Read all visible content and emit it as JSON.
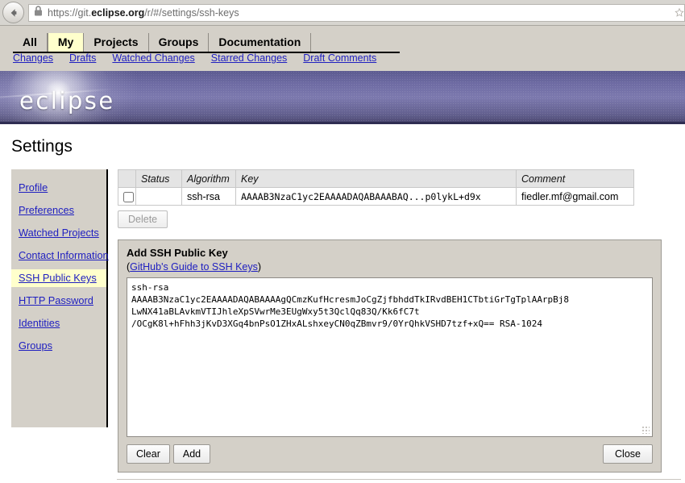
{
  "browser": {
    "url_prefix": "https://git.",
    "url_domain": "eclipse.org",
    "url_suffix": "/r/#/settings/ssh-keys",
    "back_icon": "back-arrow-icon",
    "lock_icon": "lock-icon",
    "star_icon": "star-icon"
  },
  "gerrit_nav": {
    "tabs": [
      {
        "label": "All",
        "selected": false
      },
      {
        "label": "My",
        "selected": true
      },
      {
        "label": "Projects",
        "selected": false
      },
      {
        "label": "Groups",
        "selected": false
      },
      {
        "label": "Documentation",
        "selected": false
      }
    ],
    "subtabs": [
      "Changes",
      "Drafts",
      "Watched Changes",
      "Starred Changes",
      "Draft Comments"
    ]
  },
  "banner": {
    "wordmark": "eclipse"
  },
  "page": {
    "title": "Settings"
  },
  "sidebar": {
    "items": [
      {
        "label": "Profile",
        "active": false
      },
      {
        "label": "Preferences",
        "active": false
      },
      {
        "label": "Watched Projects",
        "active": false
      },
      {
        "label": "Contact Information",
        "active": false
      },
      {
        "label": "SSH Public Keys",
        "active": true
      },
      {
        "label": "HTTP Password",
        "active": false
      },
      {
        "label": "Identities",
        "active": false
      },
      {
        "label": "Groups",
        "active": false
      }
    ]
  },
  "keys_table": {
    "columns": [
      "",
      "Status",
      "Algorithm",
      "Key",
      "Comment"
    ],
    "rows": [
      {
        "checked": false,
        "status": "",
        "algorithm": "ssh-rsa",
        "key": "AAAAB3NzaC1yc2EAAAADAQABAAABAQ...p0lykL+d9x",
        "comment": "fiedler.mf@gmail.com"
      }
    ],
    "delete_label": "Delete",
    "delete_disabled": true
  },
  "add_panel": {
    "title": "Add SSH Public Key",
    "guide_open": "(",
    "guide_link": "GitHub's Guide to SSH Keys",
    "guide_close": ")",
    "textarea_value": "ssh-rsa\nAAAAB3NzaC1yc2EAAAADAQABAAAAgQCmzKufHcresmJoCgZjfbhddTkIRvdBEH1CTbtiGrTgTplAArpBj8\nLwNX41aBLAvkmVTIJhleXpSVwrMe3EUgWxy5t3QclQq83Q/Kk6fC7t\n/OCgK8l+hFhh3jKvD3XGq4bnPsO1ZHxALshxeyCN0qZBmvr9/0YrQhkVSHD7tzf+xQ== RSA-1024",
    "clear_label": "Clear",
    "add_label": "Add",
    "close_label": "Close"
  },
  "colors": {
    "chrome_bg": "#d7d5d0",
    "gerrit_bg": "#d4d0c8",
    "link": "#2020c0",
    "highlight": "#ffffcc",
    "banner_purple": "#6e6ba3"
  }
}
